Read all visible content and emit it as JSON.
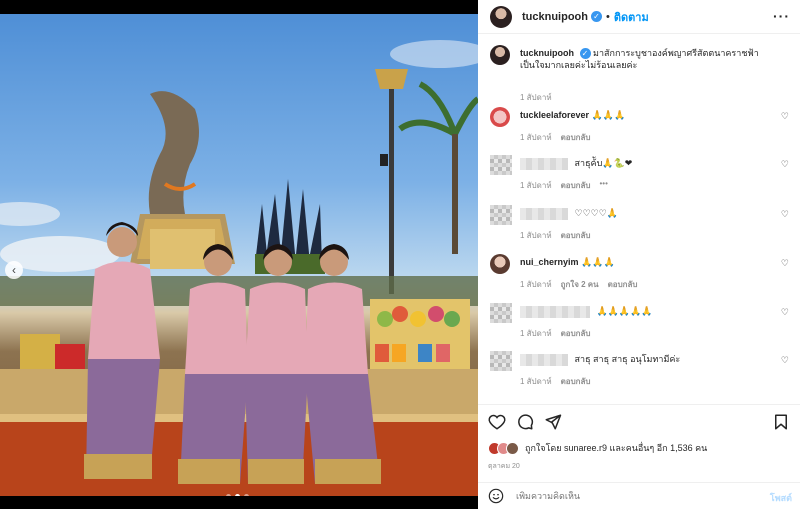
{
  "colors": {
    "accent": "#0095f6",
    "verified": "#3897f0",
    "meta": "#8e8e8e"
  },
  "header": {
    "username": "tucknuipooh",
    "separator": "•",
    "follow_label": "ติดตาม",
    "more_icon": "more-icon"
  },
  "caption": {
    "username": "tucknuipooh",
    "text": "มาสักการะบูชาองค์พญาศรีสัตตนาคราชฟ้าเป็นใจมากเลยค่ะไม่ร้อนเลยค่ะ",
    "time": "1 สัปดาห์"
  },
  "comments": [
    {
      "username": "tuckleelaforever",
      "text": "🙏🙏🙏",
      "time": "1 สัปดาห์",
      "reply": "ตอบกลับ",
      "likes": ""
    },
    {
      "username": "",
      "text": "สาธุค้ับ🙏🐍❤",
      "time": "1 สัปดาห์",
      "reply": "ตอบกลับ",
      "likes": "",
      "extra": "•••"
    },
    {
      "username": "",
      "text": "♡♡♡♡🙏",
      "time": "1 สัปดาห์",
      "reply": "ตอบกลับ",
      "likes": ""
    },
    {
      "username": "nui_chernyim",
      "text": "🙏🙏🙏",
      "time": "1 สัปดาห์",
      "reply": "ตอบกลับ",
      "likes": "ถูกใจ 2 คน"
    },
    {
      "username": "",
      "text": "🙏🙏🙏🙏🙏",
      "time": "1 สัปดาห์",
      "reply": "ตอบกลับ",
      "likes": ""
    },
    {
      "username": "",
      "text": "สาธุ สาธุ สาธุ อนุโมทามีค่ะ",
      "time": "1 สัปดาห์",
      "reply": "ตอบกลับ",
      "likes": ""
    }
  ],
  "likes": {
    "text": "ถูกใจโดย sunaree.r9 และคนอื่นๆ อีก 1,536 คน"
  },
  "post_date": "ตุลาคม 20",
  "add_comment": {
    "placeholder": "เพิ่มความคิดเห็น",
    "post_label": "โพสต์"
  }
}
